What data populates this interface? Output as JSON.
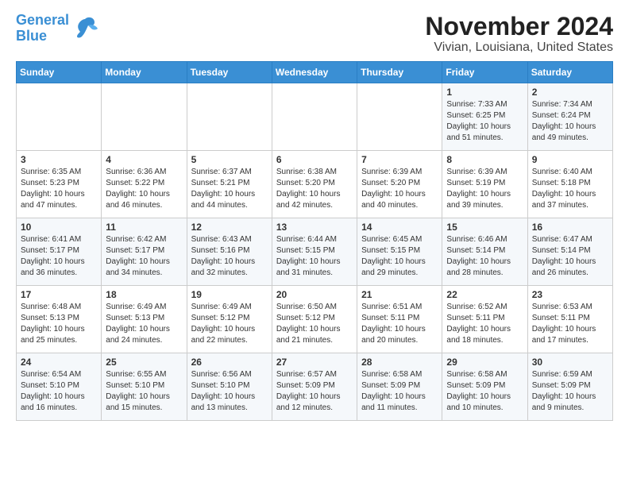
{
  "logo": {
    "line1": "General",
    "line2": "Blue"
  },
  "title": "November 2024",
  "subtitle": "Vivian, Louisiana, United States",
  "days_of_week": [
    "Sunday",
    "Monday",
    "Tuesday",
    "Wednesday",
    "Thursday",
    "Friday",
    "Saturday"
  ],
  "weeks": [
    [
      {
        "day": "",
        "info": ""
      },
      {
        "day": "",
        "info": ""
      },
      {
        "day": "",
        "info": ""
      },
      {
        "day": "",
        "info": ""
      },
      {
        "day": "",
        "info": ""
      },
      {
        "day": "1",
        "info": "Sunrise: 7:33 AM\nSunset: 6:25 PM\nDaylight: 10 hours and 51 minutes."
      },
      {
        "day": "2",
        "info": "Sunrise: 7:34 AM\nSunset: 6:24 PM\nDaylight: 10 hours and 49 minutes."
      }
    ],
    [
      {
        "day": "3",
        "info": "Sunrise: 6:35 AM\nSunset: 5:23 PM\nDaylight: 10 hours and 47 minutes."
      },
      {
        "day": "4",
        "info": "Sunrise: 6:36 AM\nSunset: 5:22 PM\nDaylight: 10 hours and 46 minutes."
      },
      {
        "day": "5",
        "info": "Sunrise: 6:37 AM\nSunset: 5:21 PM\nDaylight: 10 hours and 44 minutes."
      },
      {
        "day": "6",
        "info": "Sunrise: 6:38 AM\nSunset: 5:20 PM\nDaylight: 10 hours and 42 minutes."
      },
      {
        "day": "7",
        "info": "Sunrise: 6:39 AM\nSunset: 5:20 PM\nDaylight: 10 hours and 40 minutes."
      },
      {
        "day": "8",
        "info": "Sunrise: 6:39 AM\nSunset: 5:19 PM\nDaylight: 10 hours and 39 minutes."
      },
      {
        "day": "9",
        "info": "Sunrise: 6:40 AM\nSunset: 5:18 PM\nDaylight: 10 hours and 37 minutes."
      }
    ],
    [
      {
        "day": "10",
        "info": "Sunrise: 6:41 AM\nSunset: 5:17 PM\nDaylight: 10 hours and 36 minutes."
      },
      {
        "day": "11",
        "info": "Sunrise: 6:42 AM\nSunset: 5:17 PM\nDaylight: 10 hours and 34 minutes."
      },
      {
        "day": "12",
        "info": "Sunrise: 6:43 AM\nSunset: 5:16 PM\nDaylight: 10 hours and 32 minutes."
      },
      {
        "day": "13",
        "info": "Sunrise: 6:44 AM\nSunset: 5:15 PM\nDaylight: 10 hours and 31 minutes."
      },
      {
        "day": "14",
        "info": "Sunrise: 6:45 AM\nSunset: 5:15 PM\nDaylight: 10 hours and 29 minutes."
      },
      {
        "day": "15",
        "info": "Sunrise: 6:46 AM\nSunset: 5:14 PM\nDaylight: 10 hours and 28 minutes."
      },
      {
        "day": "16",
        "info": "Sunrise: 6:47 AM\nSunset: 5:14 PM\nDaylight: 10 hours and 26 minutes."
      }
    ],
    [
      {
        "day": "17",
        "info": "Sunrise: 6:48 AM\nSunset: 5:13 PM\nDaylight: 10 hours and 25 minutes."
      },
      {
        "day": "18",
        "info": "Sunrise: 6:49 AM\nSunset: 5:13 PM\nDaylight: 10 hours and 24 minutes."
      },
      {
        "day": "19",
        "info": "Sunrise: 6:49 AM\nSunset: 5:12 PM\nDaylight: 10 hours and 22 minutes."
      },
      {
        "day": "20",
        "info": "Sunrise: 6:50 AM\nSunset: 5:12 PM\nDaylight: 10 hours and 21 minutes."
      },
      {
        "day": "21",
        "info": "Sunrise: 6:51 AM\nSunset: 5:11 PM\nDaylight: 10 hours and 20 minutes."
      },
      {
        "day": "22",
        "info": "Sunrise: 6:52 AM\nSunset: 5:11 PM\nDaylight: 10 hours and 18 minutes."
      },
      {
        "day": "23",
        "info": "Sunrise: 6:53 AM\nSunset: 5:11 PM\nDaylight: 10 hours and 17 minutes."
      }
    ],
    [
      {
        "day": "24",
        "info": "Sunrise: 6:54 AM\nSunset: 5:10 PM\nDaylight: 10 hours and 16 minutes."
      },
      {
        "day": "25",
        "info": "Sunrise: 6:55 AM\nSunset: 5:10 PM\nDaylight: 10 hours and 15 minutes."
      },
      {
        "day": "26",
        "info": "Sunrise: 6:56 AM\nSunset: 5:10 PM\nDaylight: 10 hours and 13 minutes."
      },
      {
        "day": "27",
        "info": "Sunrise: 6:57 AM\nSunset: 5:09 PM\nDaylight: 10 hours and 12 minutes."
      },
      {
        "day": "28",
        "info": "Sunrise: 6:58 AM\nSunset: 5:09 PM\nDaylight: 10 hours and 11 minutes."
      },
      {
        "day": "29",
        "info": "Sunrise: 6:58 AM\nSunset: 5:09 PM\nDaylight: 10 hours and 10 minutes."
      },
      {
        "day": "30",
        "info": "Sunrise: 6:59 AM\nSunset: 5:09 PM\nDaylight: 10 hours and 9 minutes."
      }
    ]
  ]
}
